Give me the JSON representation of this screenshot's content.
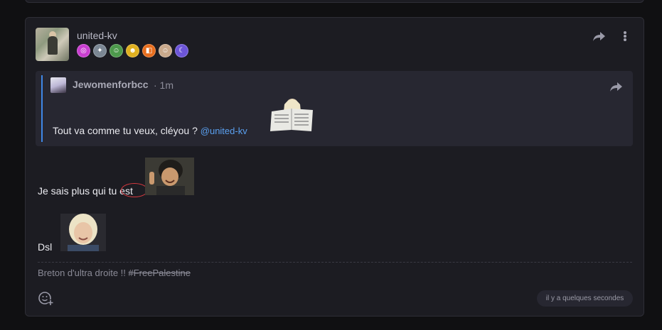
{
  "post": {
    "author": "united-kv",
    "badges": [
      {
        "icon": "pink-swirl-badge-icon",
        "color": "#c93ed0",
        "glyph": "◎"
      },
      {
        "icon": "robot-badge-icon",
        "color": "#7b8794",
        "glyph": "✦"
      },
      {
        "icon": "elf-badge-icon",
        "color": "#4d9a4c",
        "glyph": "☺"
      },
      {
        "icon": "laugh-badge-icon",
        "color": "#e0b020",
        "glyph": "☻"
      },
      {
        "icon": "orange-logo-badge-icon",
        "color": "#e76d1d",
        "glyph": "◧"
      },
      {
        "icon": "face-badge-icon",
        "color": "#c9a98c",
        "glyph": "☺"
      },
      {
        "icon": "purple-moon-badge-icon",
        "color": "#6c55d8",
        "glyph": "☾"
      }
    ],
    "quote": {
      "author": "Jewomenforbcc",
      "time": "· 1m",
      "text": "Tout va comme tu veux, cléyou ?",
      "mention": "@united-kv"
    },
    "line1": "Je sais plus qui tu est",
    "line2": "Dsl",
    "signature_text": "Breton d'ultra droite !! ",
    "signature_tag": "#FreePalestine",
    "timestamp": "il y a quelques secondes"
  },
  "colors": {
    "background": "#101012",
    "card": "#1c1c22",
    "quote_bg": "#272731",
    "quote_accent": "#3f87e6",
    "mention": "#5aa0f0",
    "highlight_circle": "#d8393f"
  }
}
